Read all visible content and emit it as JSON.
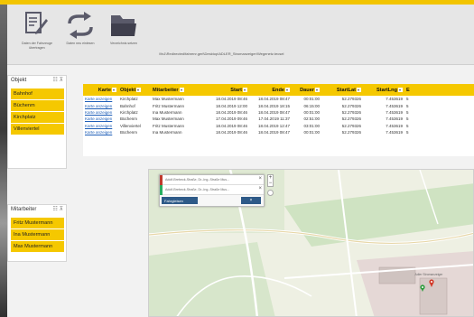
{
  "toolbar": {
    "buttons": [
      {
        "icon": "edit-document-icon",
        "label": "Daten der Fahrzeuge übertragen"
      },
      {
        "icon": "sync-arrows-icon",
        "label": "Daten neu einlesen"
      },
      {
        "icon": "folder-icon",
        "label": "Verzeichnis setzen"
      }
    ],
    "path": "\\\\fs1\\Redirected\\fahrenr.gerl\\Desktop\\ADLER_Stromanzeiger\\Wegenetz.tecsel"
  },
  "slicers": {
    "objekt": {
      "title": "Objekt",
      "items": [
        "Bahnhof",
        "Büchenm",
        "Kirchplatz",
        "Villenviertel"
      ]
    },
    "mitarbeiter": {
      "title": "Mitarbeiter",
      "items": [
        "Fritz Mustermann",
        "Ina Mustermann",
        "Max Mustermann"
      ]
    }
  },
  "table": {
    "columns": [
      "Karte",
      "Objekt",
      "Mitarbeiter",
      "Start",
      "Ende",
      "Dauer",
      "StartLat",
      "StartLng",
      "E"
    ],
    "rows": [
      [
        "Karte anzeigen",
        "Kirchplatz",
        "Max Mustermann",
        "18.04.2019 08:46",
        "18.04.2019 08:47",
        "00:01:00",
        "52.279326",
        "7.453619",
        "5"
      ],
      [
        "Karte anzeigen",
        "Bahnhof",
        "Fritz Mustermann",
        "18.04.2019 12:00",
        "18.04.2019 18:15",
        "06:15:00",
        "52.279326",
        "7.453619",
        "5"
      ],
      [
        "Karte anzeigen",
        "Kirchplatz",
        "Ina Mustermann",
        "18.04.2019 08:46",
        "18.04.2019 08:47",
        "00:01:00",
        "52.279326",
        "7.453619",
        "5"
      ],
      [
        "Karte anzeigen",
        "Büchenm",
        "Max Mustermann",
        "17.04.2019 09:46",
        "17.04.2019 11:37",
        "02:51:00",
        "52.279326",
        "7.453619",
        "5"
      ],
      [
        "Karte anzeigen",
        "Villenviertel",
        "Fritz Mustermann",
        "18.04.2019 08:46",
        "18.04.2019 12:47",
        "03:01:00",
        "52.279326",
        "7.453619",
        "5"
      ],
      [
        "Karte anzeigen",
        "Büchenm",
        "Ina Mustermann",
        "18.04.2019 08:46",
        "18.04.2019 08:47",
        "00:01:00",
        "52.279326",
        "7.453619",
        "5"
      ]
    ]
  },
  "map": {
    "routes": [
      {
        "color": "#c0392b",
        "text": "Adolf-Brebeck-Straße, Dr.-Ing.-Straße Mus..."
      },
      {
        "color": "#27ae60",
        "text": "Adolf-Brebeck-Straße, Dr.-Ing.-Straße Mus..."
      }
    ],
    "route_select": "Fahrgleisen",
    "route_button": "×",
    "place_label": "Adler Stromanzeiger",
    "zoom_in": "+",
    "zoom_out": "−"
  },
  "colors": {
    "accent": "#f5c800",
    "link": "#1f5fb8",
    "map_button": "#2e5a88"
  }
}
